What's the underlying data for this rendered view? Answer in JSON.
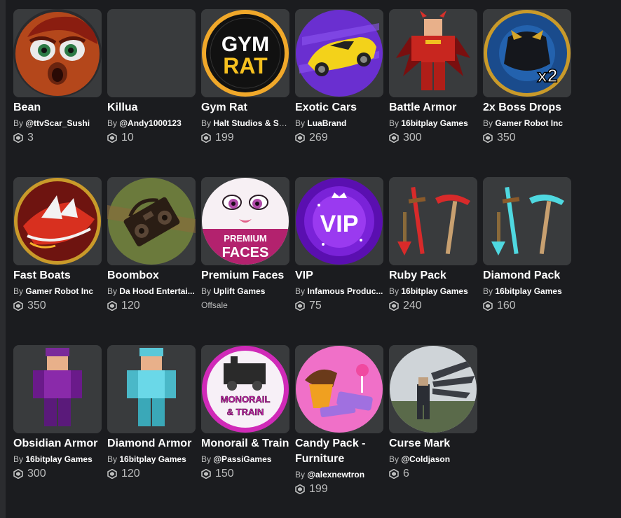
{
  "items": [
    {
      "name": "Bean",
      "by": "By",
      "creator": "@ttvScar_Sushi",
      "price": "3",
      "icon": "bean-face-image"
    },
    {
      "name": "Killua",
      "by": "By",
      "creator": "@Andy1000123",
      "price": "10",
      "icon": "blank-image"
    },
    {
      "name": "Gym Rat",
      "by": "By",
      "creator": "Halt Studios & Sp...",
      "price": "199",
      "icon": "gym-rat-logo",
      "logo_text_1": "GYM",
      "logo_text_2": "RAT"
    },
    {
      "name": "Exotic Cars",
      "by": "By",
      "creator": "LuaBrand",
      "price": "269",
      "icon": "yellow-car-image"
    },
    {
      "name": "Battle Armor",
      "by": "By",
      "creator": "16bitplay Games",
      "price": "300",
      "icon": "red-armor-avatar"
    },
    {
      "name": "2x Boss Drops",
      "by": "By",
      "creator": "Gamer Robot Inc",
      "price": "350",
      "icon": "boss-drops-image",
      "logo_text": "x2"
    },
    {
      "name": "Fast Boats",
      "by": "By",
      "creator": "Gamer Robot Inc",
      "price": "350",
      "icon": "fast-boat-image"
    },
    {
      "name": "Boombox",
      "by": "By",
      "creator": "Da Hood Entertai...",
      "price": "120",
      "icon": "boombox-image"
    },
    {
      "name": "Premium Faces",
      "by": "By",
      "creator": "Uplift Games",
      "offsale": "Offsale",
      "icon": "premium-faces-image",
      "logo_text_1": "PREMIUM",
      "logo_text_2": "FACES"
    },
    {
      "name": "VIP",
      "by": "By",
      "creator": "Infamous Produc...",
      "price": "75",
      "icon": "vip-badge-image",
      "logo_text": "VIP"
    },
    {
      "name": "Ruby Pack",
      "by": "By",
      "creator": "16bitplay Games",
      "price": "240",
      "icon": "ruby-tools-image"
    },
    {
      "name": "Diamond Pack",
      "by": "By",
      "creator": "16bitplay Games",
      "price": "160",
      "icon": "diamond-tools-image"
    },
    {
      "name": "Obsidian Armor",
      "by": "By",
      "creator": "16bitplay Games",
      "price": "300",
      "icon": "obsidian-armor-avatar"
    },
    {
      "name": "Diamond Armor",
      "by": "By",
      "creator": "16bitplay Games",
      "price": "120",
      "icon": "diamond-armor-avatar"
    },
    {
      "name": "Monorail & Train",
      "by": "By",
      "creator": "@PassiGames",
      "price": "150",
      "icon": "monorail-train-image",
      "logo_text_1": "MONORAIL",
      "logo_text_2": "& TRAIN"
    },
    {
      "name": "Candy Pack - Furniture",
      "by": "By",
      "creator": "@alexnewtron",
      "price": "199",
      "icon": "candy-pack-image"
    },
    {
      "name": "Curse Mark",
      "by": "By",
      "creator": "@Coldjason",
      "price": "6",
      "icon": "curse-mark-image"
    }
  ],
  "colors": {
    "background": "#1b1c1f",
    "tile": "#393b3d",
    "secondary_text": "#bdbebe"
  }
}
